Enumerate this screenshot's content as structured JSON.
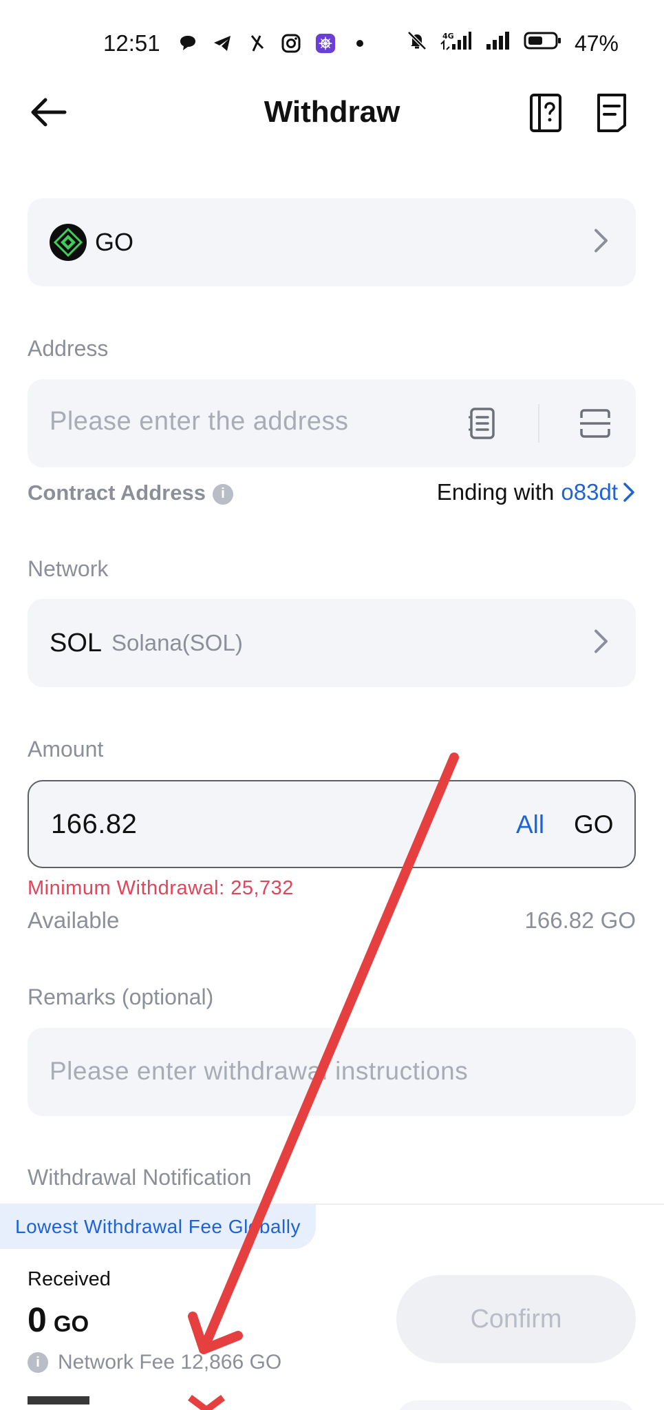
{
  "status_bar": {
    "time": "12:51",
    "battery": "47%",
    "network_type": "4G",
    "icons": [
      "chat-bubble-icon",
      "telegram-icon",
      "app-icon",
      "instagram-icon",
      "app-tile-icon",
      "dot-icon",
      "mute-bell-icon",
      "signal-icon",
      "signal-icon",
      "battery-icon"
    ]
  },
  "nav": {
    "title": "Withdraw",
    "back_icon": "arrow-left-icon",
    "guide_icon": "help-book-icon",
    "record_icon": "document-icon"
  },
  "coin": {
    "name": "GO",
    "logo_icon": "go-coin-logo-icon"
  },
  "address": {
    "label": "Address",
    "placeholder": "Please enter the address",
    "contract_label": "Contract Address",
    "contract_prefix": "Ending with",
    "contract_suffix": "o83dt"
  },
  "network": {
    "label": "Network",
    "code": "SOL",
    "name": "Solana(SOL)"
  },
  "amount": {
    "label": "Amount",
    "value": "166.82",
    "all_label": "All",
    "unit": "GO",
    "min_withdrawal": "Minimum Withdrawal: 25,732",
    "available_label": "Available",
    "available_value": "166.82 GO"
  },
  "remarks": {
    "label": "Remarks (optional)",
    "placeholder": "Please enter withdrawal instructions"
  },
  "notification": {
    "label": "Withdrawal Notification"
  },
  "bottom": {
    "promo": "Lowest Withdrawal Fee Globally",
    "received_label": "Received",
    "received_value": "0",
    "received_unit": "GO",
    "network_fee": "Network Fee 12,866 GO",
    "confirm_label": "Confirm"
  },
  "colors": {
    "accent_blue": "#1e63d6",
    "error_red": "#e0455a",
    "annotation_red": "#e5403f",
    "field_bg": "#f4f5f9"
  }
}
